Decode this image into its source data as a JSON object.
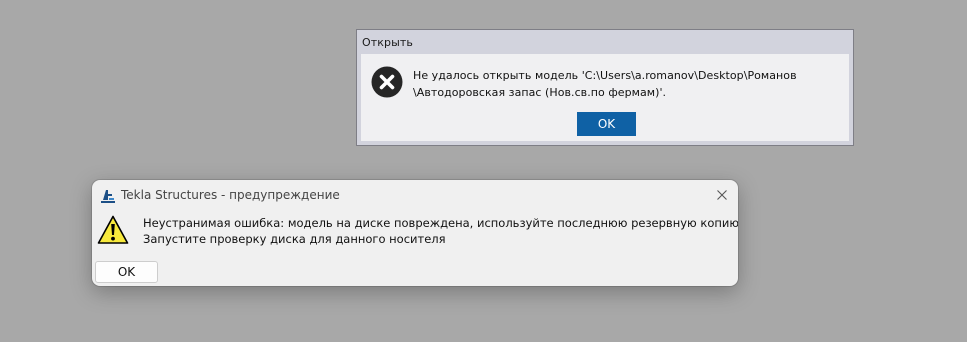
{
  "open_dialog": {
    "title": "Открыть",
    "icon": "error-icon",
    "message_line1": "Не удалось открыть модель 'C:\\Users\\a.romanov\\Desktop\\Романов",
    "message_line2": "\\Автодоровская запас (Нов.св.по фермам)'.",
    "ok_label": "OK",
    "accent_color": "#0f61a5"
  },
  "tekla_dialog": {
    "title": "Tekla Structures - предупреждение",
    "app_icon": "tekla-icon",
    "warning_icon": "warning-icon",
    "message_line1": "Неустранимая ошибка: модель на диске повреждена, используйте последнюю резервную копию модели.",
    "message_line2": "Запустите проверку диска для данного носителя",
    "ok_label": "OK",
    "close_icon": "close-icon"
  }
}
